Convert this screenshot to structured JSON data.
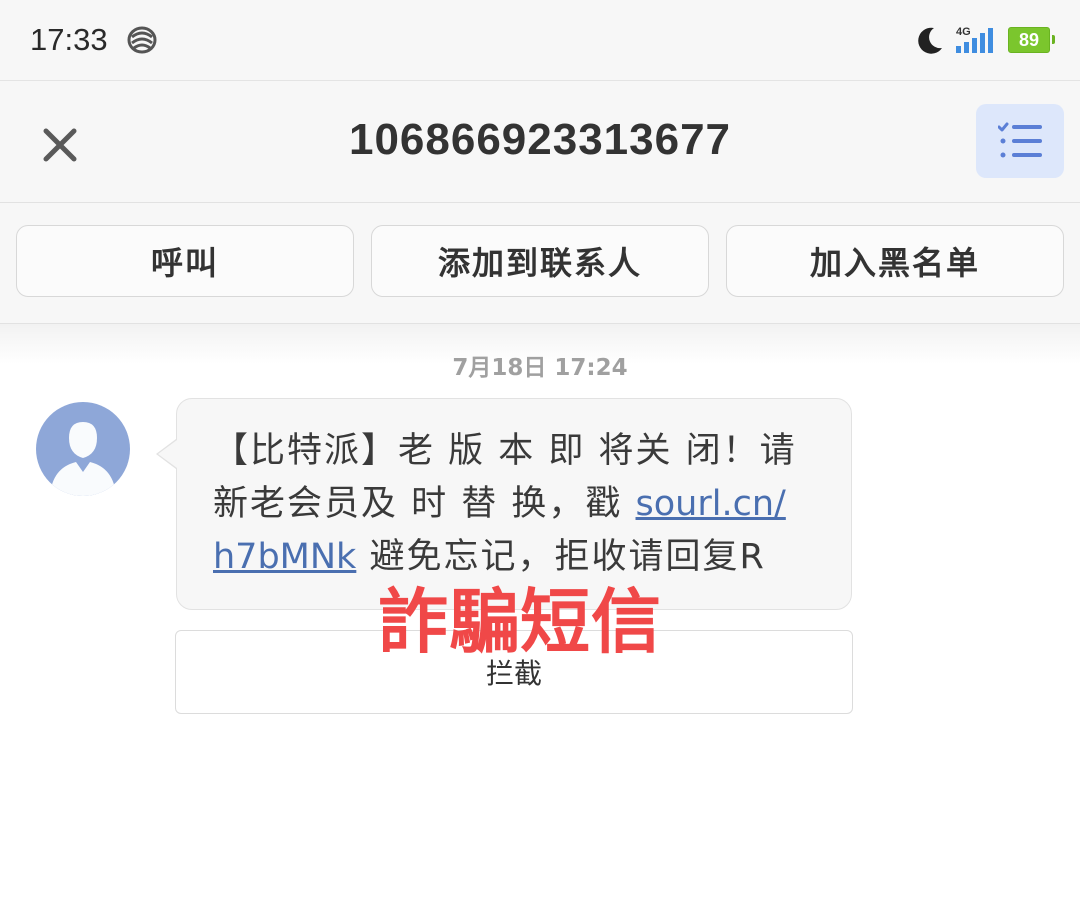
{
  "status_bar": {
    "time": "17:33",
    "network": "4G",
    "battery": "89",
    "icons": [
      "carrier-icon",
      "moon-icon",
      "signal-icon",
      "battery-icon"
    ],
    "battery_color": "#7bc62d"
  },
  "header": {
    "title": "106866923313677",
    "icons": [
      "close-icon",
      "list-menu-icon"
    ],
    "menu_accent": "#5b7fd6"
  },
  "actions": {
    "call": "呼叫",
    "add_contact": "添加到联系人",
    "blacklist": "加入黑名单"
  },
  "conversation": {
    "timestamp": "7月18日 17:24",
    "message": {
      "line1": "【比特派】老 版 本 即 将关 闭！请",
      "line2_prefix": "新老会员及 时 替 换，戳 ",
      "link_part1": "sourl.cn/",
      "link_part2": "h7bMNk",
      "line3_suffix": " 避免忘记，拒收请回复R",
      "link_color": "#4a6fb0"
    },
    "intercept_label": "拦截",
    "avatar_color": "#8ea7d8"
  },
  "overlay": {
    "watermark": "詐騙短信",
    "color": "#f04848"
  }
}
